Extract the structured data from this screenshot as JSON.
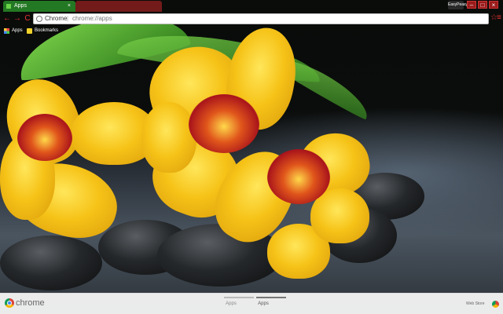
{
  "tabs": [
    {
      "label": "Apps",
      "active": true
    },
    {
      "label": "",
      "active": false
    }
  ],
  "window": {
    "profile_label": "EasyPeasy",
    "minimize": "–",
    "maximize": "□",
    "close": "×"
  },
  "toolbar": {
    "back": "←",
    "forward": "→",
    "reload": "C",
    "omnibox_site": "Chrome",
    "omnibox_separator": "|",
    "omnibox_url": "chrome://apps",
    "star": "☆",
    "menu": "≡"
  },
  "bookmarks": {
    "apps": "Apps",
    "bookmarks": "Bookmarks"
  },
  "bottom": {
    "brand": "chrome",
    "page_tabs": [
      "Apps",
      "Apps"
    ],
    "selected_page_tab": 1,
    "web_store": "Web Store"
  },
  "colors": {
    "accent": "#e33333",
    "active_tab": "#2e8c2e"
  }
}
